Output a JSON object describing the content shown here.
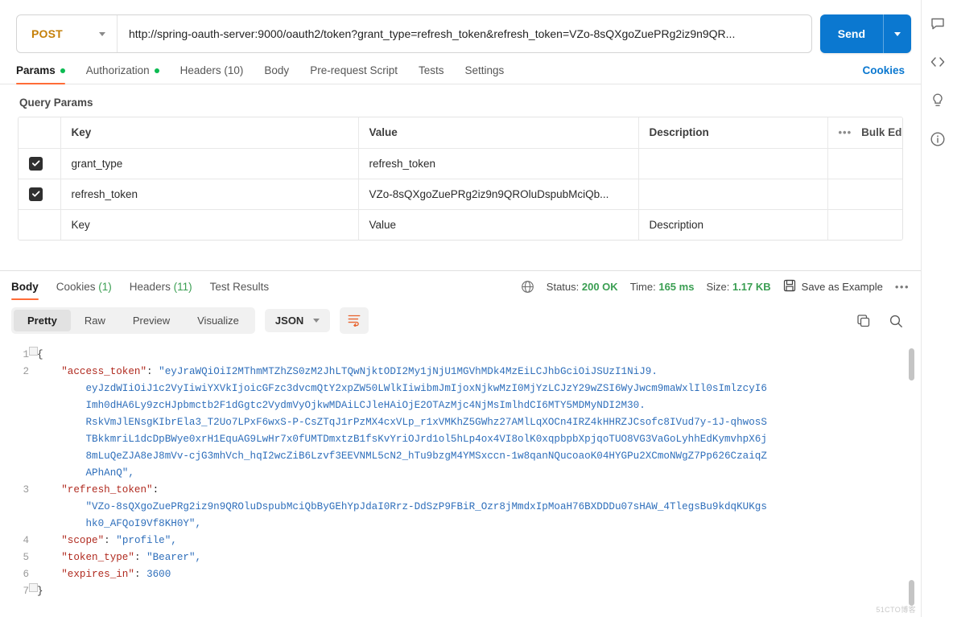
{
  "request": {
    "method": "POST",
    "url": "http://spring-oauth-server:9000/oauth2/token?grant_type=refresh_token&refresh_token=VZo-8sQXgoZuePRg2iz9n9QR...",
    "send_label": "Send",
    "tabs": [
      {
        "label": "Params",
        "dot": true
      },
      {
        "label": "Authorization",
        "dot": true
      },
      {
        "label": "Headers (10)",
        "dot": false
      },
      {
        "label": "Body",
        "dot": false
      },
      {
        "label": "Pre-request Script",
        "dot": false
      },
      {
        "label": "Tests",
        "dot": false
      },
      {
        "label": "Settings",
        "dot": false
      }
    ],
    "cookies_link": "Cookies"
  },
  "params": {
    "section_title": "Query Params",
    "columns": [
      "Key",
      "Value",
      "Description"
    ],
    "bulk_edit": "Bulk Edit",
    "rows": [
      {
        "checked": true,
        "key": "grant_type",
        "value": "refresh_token",
        "description": ""
      },
      {
        "checked": true,
        "key": "refresh_token",
        "value": "VZo-8sQXgoZuePRg2iz9n9QROluDspubMciQb...",
        "description": ""
      }
    ],
    "placeholder_row": {
      "key": "Key",
      "value": "Value",
      "description": "Description"
    }
  },
  "response": {
    "tabs": [
      {
        "label": "Body",
        "count": ""
      },
      {
        "label": "Cookies",
        "count": "(1)"
      },
      {
        "label": "Headers",
        "count": "(11)"
      },
      {
        "label": "Test Results",
        "count": ""
      }
    ],
    "status_label": "Status:",
    "status_value": "200 OK",
    "time_label": "Time:",
    "time_value": "165 ms",
    "size_label": "Size:",
    "size_value": "1.17 KB",
    "save_as_example": "Save as Example",
    "view_modes": [
      "Pretty",
      "Raw",
      "Preview",
      "Visualize"
    ],
    "active_view": "Pretty",
    "format": "JSON",
    "body_lines": [
      {
        "n": "1",
        "content": "{",
        "type": "brace",
        "fold": true
      },
      {
        "n": "2",
        "content": "    \"access_token\": \"eyJraWQiOiI2MThmMTZhZS0zM2JhLTQwNjktODI2My1jNjU1MGVhMDk4MzEiLCJhbGciOiJSUzI1NiJ9.",
        "type": "kv"
      },
      {
        "n": "",
        "content": "        eyJzdWIiOiJ1c2VyIiwiYXVkIjoicGFzc3dvcmQtY2xpZW50LWlkIiwibmJmIjoxNjkwMzI0MjYzLCJzY29wZSI6WyJwcm9maWxlIl0sImlzcyI6",
        "type": "cont"
      },
      {
        "n": "",
        "content": "        Imh0dHA6Ly9zcHJpbmctb2F1dGgtc2VydmVyOjkwMDAiLCJleHAiOjE2OTAzMjc4NjMsImlhdCI6MTY5MDMyNDI2M30.",
        "type": "cont"
      },
      {
        "n": "",
        "content": "        RskVmJlENsgKIbrEla3_T2Uo7LPxF6wxS-P-CsZTqJ1rPzMX4cxVLp_r1xVMKhZ5GWhz27AMlLqXOCn4IRZ4kHHRZJCsofc8IVud7y-1J-qhwosS",
        "type": "cont"
      },
      {
        "n": "",
        "content": "        TBkkmriL1dcDpBWye0xrH1EquAG9LwHr7x0fUMTDmxtzB1fsKvYriOJrd1ol5hLp4ox4VI8olK0xqpbpbXpjqoTUO8VG3VaGoLyhhEdKymvhpX6j",
        "type": "cont"
      },
      {
        "n": "",
        "content": "        8mLuQeZJA8eJ8mVv-cjG3mhVch_hqI2wcZiB6Lzvf3EEVNML5cN2_hTu9bzgM4YMSxccn-1w8qanNQucoaoK04HYGPu2XCmoNWgZ7Pp626CzaiqZ",
        "type": "cont"
      },
      {
        "n": "",
        "content": "        APhAnQ\",",
        "type": "cont-end"
      },
      {
        "n": "3",
        "content": "    \"refresh_token\":",
        "type": "key-only"
      },
      {
        "n": "",
        "content": "        \"VZo-8sQXgoZuePRg2iz9n9QROluDspubMciQbByGEhYpJdaI0Rrz-DdSzP9FBiR_Ozr8jMmdxIpMoaH76BXDDDu07sHAW_4TlegsBu9kdqKUKgs",
        "type": "cont"
      },
      {
        "n": "",
        "content": "        hk0_AFQoI9Vf8KH0Y\",",
        "type": "cont-end"
      },
      {
        "n": "4",
        "content": "    \"scope\": \"profile\",",
        "type": "kv"
      },
      {
        "n": "5",
        "content": "    \"token_type\": \"Bearer\",",
        "type": "kv"
      },
      {
        "n": "6",
        "content": "    \"expires_in\": 3600",
        "type": "kvnum"
      },
      {
        "n": "7",
        "content": "}",
        "type": "brace",
        "fold": true
      }
    ],
    "watermark": "51CTO博客"
  },
  "rail_icons": [
    "comment-icon",
    "code-icon",
    "bulb-icon",
    "info-icon"
  ],
  "colors": {
    "accent": "#ff6c37",
    "send": "#0b78d0",
    "method": "#c5800a",
    "success": "#3a9e52",
    "string": "#2f6fbb",
    "key": "#b02a1f"
  }
}
